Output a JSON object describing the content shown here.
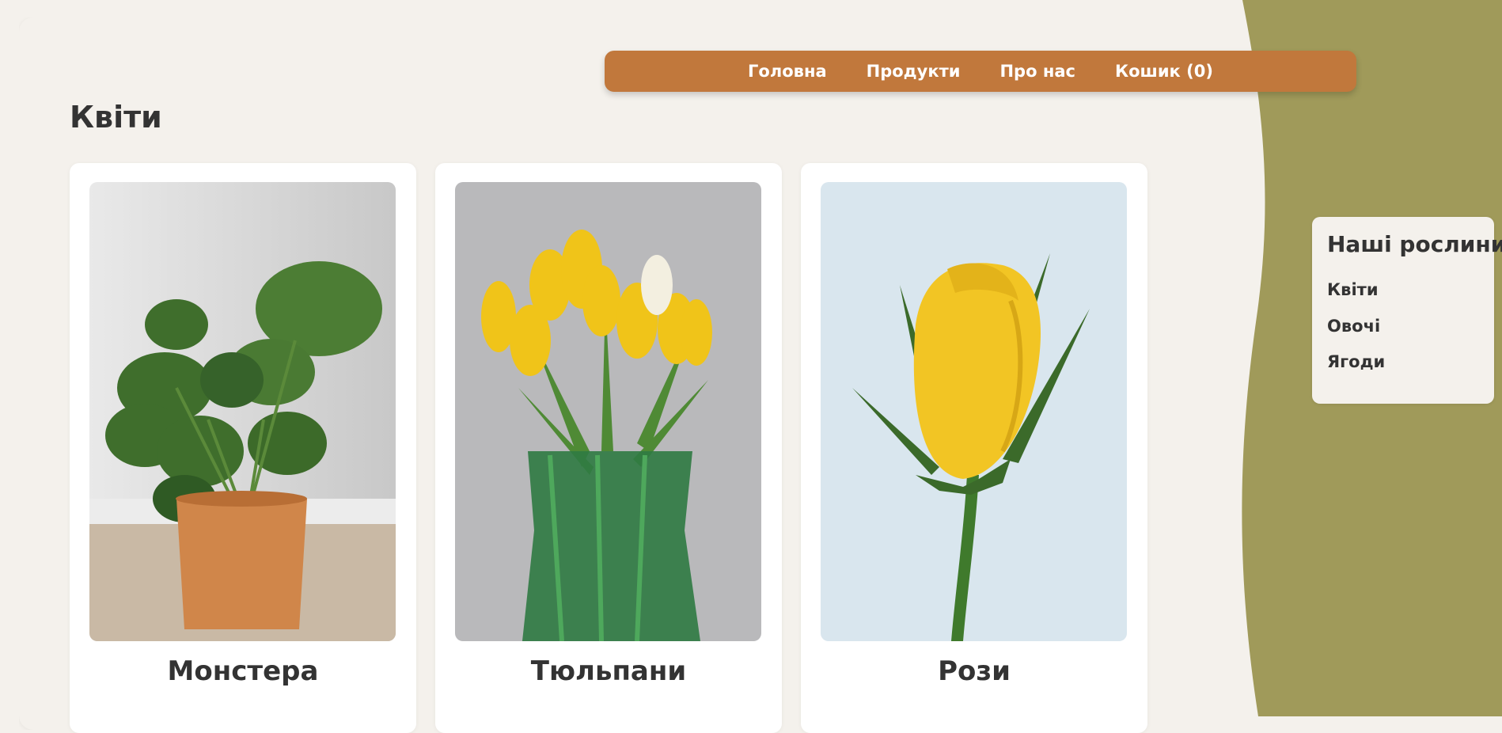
{
  "nav": {
    "home": "Головна",
    "products": "Продукти",
    "about": "Про нас",
    "cart": "Кошик (0)"
  },
  "section_title": "Квіти",
  "products": [
    {
      "name": "Монстера",
      "image": "monstera-plant-photo"
    },
    {
      "name": "Тюльпани",
      "image": "yellow-tulips-photo"
    },
    {
      "name": "Рози",
      "image": "yellow-rose-photo"
    }
  ],
  "sidebar": {
    "title": "Наші рослини",
    "items": [
      "Квіти",
      "Овочі",
      "Ягоди"
    ]
  },
  "colors": {
    "background": "#f4f1ec",
    "nav": "#c1783c",
    "olive": "#a09a5a",
    "card": "#ffffff",
    "text": "#333333"
  }
}
